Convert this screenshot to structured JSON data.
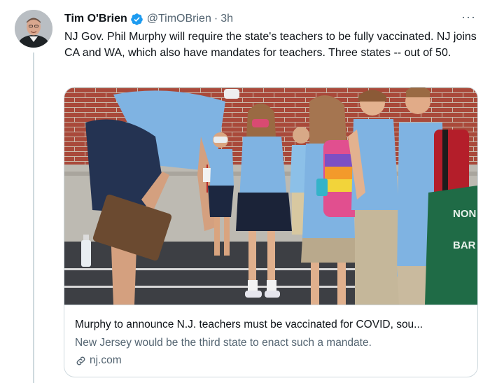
{
  "tweet": {
    "display_name": "Tim O'Brien",
    "handle": "@TimOBrien",
    "separator": "·",
    "time": "3h",
    "more": "···",
    "text": "NJ Gov. Phil Murphy will require the state's teachers to be fully vaccinated. NJ joins CA and WA, which also have mandates for teachers. Three states -- out of 50."
  },
  "card": {
    "title": "Murphy to announce N.J. teachers must be vaccinated for COVID, sou...",
    "description": "New Jersey would be the third state to enact such a mandate.",
    "domain": "nj.com",
    "banner_text_top": "NON",
    "banner_text_bottom": "BAR"
  },
  "icons": {
    "verified": "verified-badge-icon",
    "more": "more-options-icon",
    "link": "link-icon"
  },
  "colors": {
    "primary_text": "#0f1419",
    "secondary_text": "#536471",
    "verified_blue": "#1d9bf0",
    "border": "#cfd9de"
  }
}
